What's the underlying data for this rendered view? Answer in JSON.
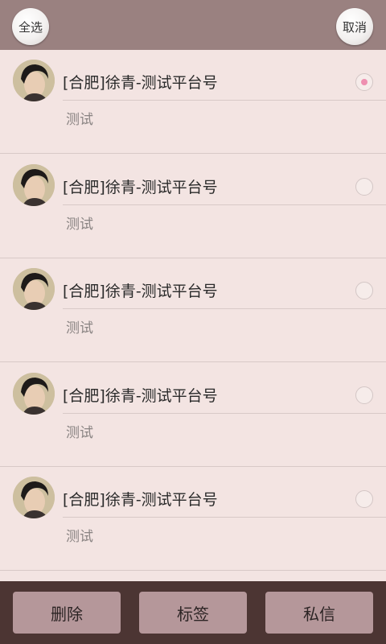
{
  "header": {
    "select_all_label": "全选",
    "cancel_label": "取消"
  },
  "contacts": [
    {
      "title": "[合肥]徐青-测试平台号",
      "subtitle": "测试",
      "selected": true
    },
    {
      "title": "[合肥]徐青-测试平台号",
      "subtitle": "测试",
      "selected": false
    },
    {
      "title": "[合肥]徐青-测试平台号",
      "subtitle": "测试",
      "selected": false
    },
    {
      "title": "[合肥]徐青-测试平台号",
      "subtitle": "测试",
      "selected": false
    },
    {
      "title": "[合肥]徐青-测试平台号",
      "subtitle": "测试",
      "selected": false
    }
  ],
  "footer": {
    "delete_label": "删除",
    "tag_label": "标签",
    "message_label": "私信"
  },
  "colors": {
    "header_bg": "#9a8180",
    "list_bg": "#f3e4e2",
    "footer_bg": "#4c3533",
    "footer_button": "#b5979a",
    "radio_selected": "#ee8fb0"
  }
}
